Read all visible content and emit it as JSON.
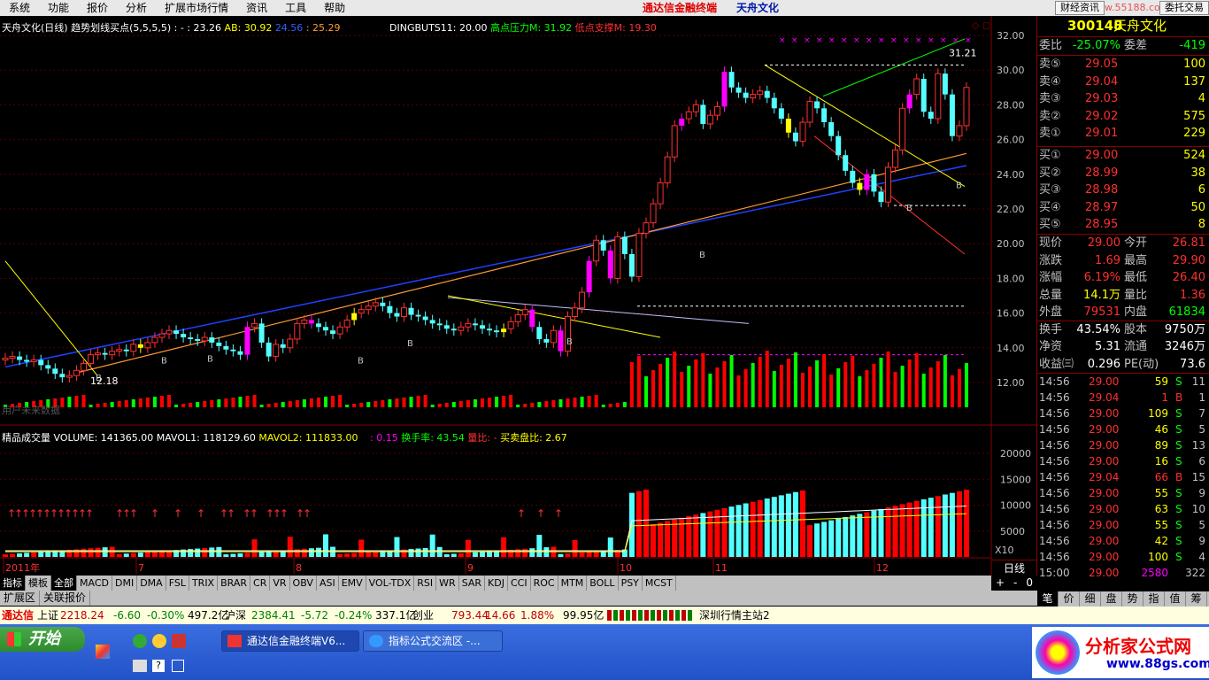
{
  "menu": {
    "items": [
      "系统",
      "功能",
      "报价",
      "分析",
      "扩展市场行情",
      "资讯",
      "工具",
      "帮助"
    ],
    "app_title": "通达信金融终端",
    "stock_title": "天舟文化",
    "btn_news": "财经资讯",
    "btn_trade": "委托交易",
    "watermark": "www.55188.com"
  },
  "chart": {
    "title": "天舟文化(日线)",
    "indicator_name": "趋势划线买点(5,5,5,5)",
    "ind_vals": {
      "a": ": - : 23.26",
      "ab": "AB: 30.92",
      "b1": "24.56",
      "b2": ": 25.29"
    },
    "dingbuts": "DINGBUTS11: 20.00",
    "resist": "高点压力M: 31.92",
    "support": "低点支撑M: 19.30",
    "hi_label": "31.21",
    "lo_label": "12.18",
    "future_label": "用户未来数据",
    "buy_marker": "B",
    "price_ticks": [
      "32.00",
      "30.00",
      "28.00",
      "26.00",
      "24.00",
      "22.00",
      "20.00",
      "18.00",
      "16.00",
      "14.00",
      "12.00"
    ],
    "vol_title": "精品成交量",
    "vol_vals": {
      "volume": "VOLUME: 141365.00",
      "mavol1": "MAVOL1: 118129.60",
      "mavol2": "MAVOL2: 111833.00",
      "v1": ": 0.15",
      "turnover": "换手率: 43.54",
      "ratio": "量比: -",
      "bsratio": "买卖盘比: 2.67"
    },
    "vol_ticks": [
      "20000",
      "15000",
      "10000",
      "5000"
    ],
    "vol_unit": "X10",
    "x_labels": [
      "2011年",
      "7",
      "8",
      "9",
      "10",
      "11",
      "12"
    ],
    "period": "日线",
    "buttons": [
      "+",
      "-",
      "0"
    ]
  },
  "quote": {
    "code": "300148",
    "name": "天舟文化",
    "weibi_label": "委比",
    "weibi": "-25.07%",
    "weicha_label": "委差",
    "weicha": "-419",
    "sell": [
      {
        "label": "卖⑤",
        "price": "29.05",
        "vol": "100"
      },
      {
        "label": "卖④",
        "price": "29.04",
        "vol": "137"
      },
      {
        "label": "卖③",
        "price": "29.03",
        "vol": "4"
      },
      {
        "label": "卖②",
        "price": "29.02",
        "vol": "575"
      },
      {
        "label": "卖①",
        "price": "29.01",
        "vol": "229"
      }
    ],
    "buy": [
      {
        "label": "买①",
        "price": "29.00",
        "vol": "524"
      },
      {
        "label": "买②",
        "price": "28.99",
        "vol": "38"
      },
      {
        "label": "买③",
        "price": "28.98",
        "vol": "6"
      },
      {
        "label": "买④",
        "price": "28.97",
        "vol": "50"
      },
      {
        "label": "买⑤",
        "price": "28.95",
        "vol": "8"
      }
    ],
    "stats": [
      {
        "l1": "现价",
        "v1": "29.00",
        "l2": "今开",
        "v2": "26.81"
      },
      {
        "l1": "涨跌",
        "v1": "1.69",
        "l2": "最高",
        "v2": "29.90"
      },
      {
        "l1": "涨幅",
        "v1": "6.19%",
        "l2": "最低",
        "v2": "26.40"
      },
      {
        "l1": "总量",
        "v1": "14.1万",
        "l2": "量比",
        "v2": "1.36"
      },
      {
        "l1": "外盘",
        "v1": "79531",
        "l2": "内盘",
        "v2": "61834"
      },
      {
        "l1": "换手",
        "v1": "43.54%",
        "l2": "股本",
        "v2": "9750万"
      },
      {
        "l1": "净资",
        "v1": "5.31",
        "l2": "流通",
        "v2": "3246万"
      },
      {
        "l1": "收益㈢",
        "v1": "0.296",
        "l2": "PE(动)",
        "v2": "73.6"
      }
    ],
    "ticks": [
      {
        "t": "14:56",
        "p": "29.00",
        "v": "59",
        "d": "S",
        "n": "11"
      },
      {
        "t": "14:56",
        "p": "29.04",
        "v": "1",
        "d": "B",
        "n": "1"
      },
      {
        "t": "14:56",
        "p": "29.00",
        "v": "109",
        "d": "S",
        "n": "7"
      },
      {
        "t": "14:56",
        "p": "29.00",
        "v": "46",
        "d": "S",
        "n": "5"
      },
      {
        "t": "14:56",
        "p": "29.00",
        "v": "89",
        "d": "S",
        "n": "13"
      },
      {
        "t": "14:56",
        "p": "29.00",
        "v": "16",
        "d": "S",
        "n": "6"
      },
      {
        "t": "14:56",
        "p": "29.04",
        "v": "66",
        "d": "B",
        "n": "15"
      },
      {
        "t": "14:56",
        "p": "29.00",
        "v": "55",
        "d": "S",
        "n": "9"
      },
      {
        "t": "14:56",
        "p": "29.00",
        "v": "63",
        "d": "S",
        "n": "10"
      },
      {
        "t": "14:56",
        "p": "29.00",
        "v": "55",
        "d": "S",
        "n": "5"
      },
      {
        "t": "14:56",
        "p": "29.00",
        "v": "42",
        "d": "S",
        "n": "9"
      },
      {
        "t": "14:56",
        "p": "29.00",
        "v": "100",
        "d": "S",
        "n": "4"
      },
      {
        "t": "15:00",
        "p": "29.00",
        "v": "2580",
        "d": "",
        "n": "322"
      }
    ],
    "tabs": [
      "笔",
      "价",
      "细",
      "盘",
      "势",
      "指",
      "值",
      "筹"
    ]
  },
  "indicator_tabs": [
    "指标",
    "模板",
    "全部",
    "MACD",
    "DMI",
    "DMA",
    "FSL",
    "TRIX",
    "BRAR",
    "CR",
    "VR",
    "OBV",
    "ASI",
    "EMV",
    "VOL-TDX",
    "RSI",
    "WR",
    "SAR",
    "KDJ",
    "CCI",
    "ROC",
    "MTM",
    "BOLL",
    "PSY",
    "MCST"
  ],
  "ext_tabs": [
    "扩展区",
    "关联报价"
  ],
  "status": {
    "brand": "通达信",
    "sh_name": "上证",
    "sh_val": "2218.24",
    "sh_chg": "-6.60",
    "sh_pct": "-0.30%",
    "sh_amt": "497.2亿",
    "sz_name": "沪深",
    "sz_val": "2384.41",
    "sz_chg": "-5.72",
    "sz_pct": "-0.24%",
    "sz_amt": "337.1亿",
    "cy_name": "创业",
    "cy_val": "793.44",
    "cy_chg": "14.66",
    "cy_pct": "1.88%",
    "cy_amt": "99.95亿",
    "server": "深圳行情主站2"
  },
  "taskbar": {
    "start": "开始",
    "task1": "通达信金融终端V6...",
    "task2": "指标公式交流区 -...",
    "logo": "分析家公式网",
    "logo_url": "www.88gs.com"
  }
}
